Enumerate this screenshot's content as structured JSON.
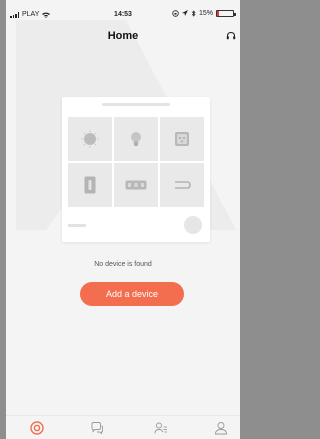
{
  "status_bar": {
    "carrier": "PLAY",
    "time": "14:53",
    "battery": "15%"
  },
  "header": {
    "title": "Home",
    "support_icon": "headset-icon"
  },
  "device_placeholder": {
    "tiles": [
      "bulb-round-icon",
      "bulb-icon",
      "socket-icon",
      "switch-icon",
      "power-strip-icon",
      "cable-icon"
    ]
  },
  "empty_state": {
    "message": "No device is found",
    "add_button_label": "Add a device"
  },
  "tab_bar": {
    "tabs": [
      "home-tab-icon",
      "messages-tab-icon",
      "sharing-tab-icon",
      "profile-tab-icon"
    ],
    "active": "home-tab-icon"
  },
  "colors": {
    "accent": "#f26e4f",
    "background": "#f4f4f4",
    "tile": "#e9e9e9"
  }
}
